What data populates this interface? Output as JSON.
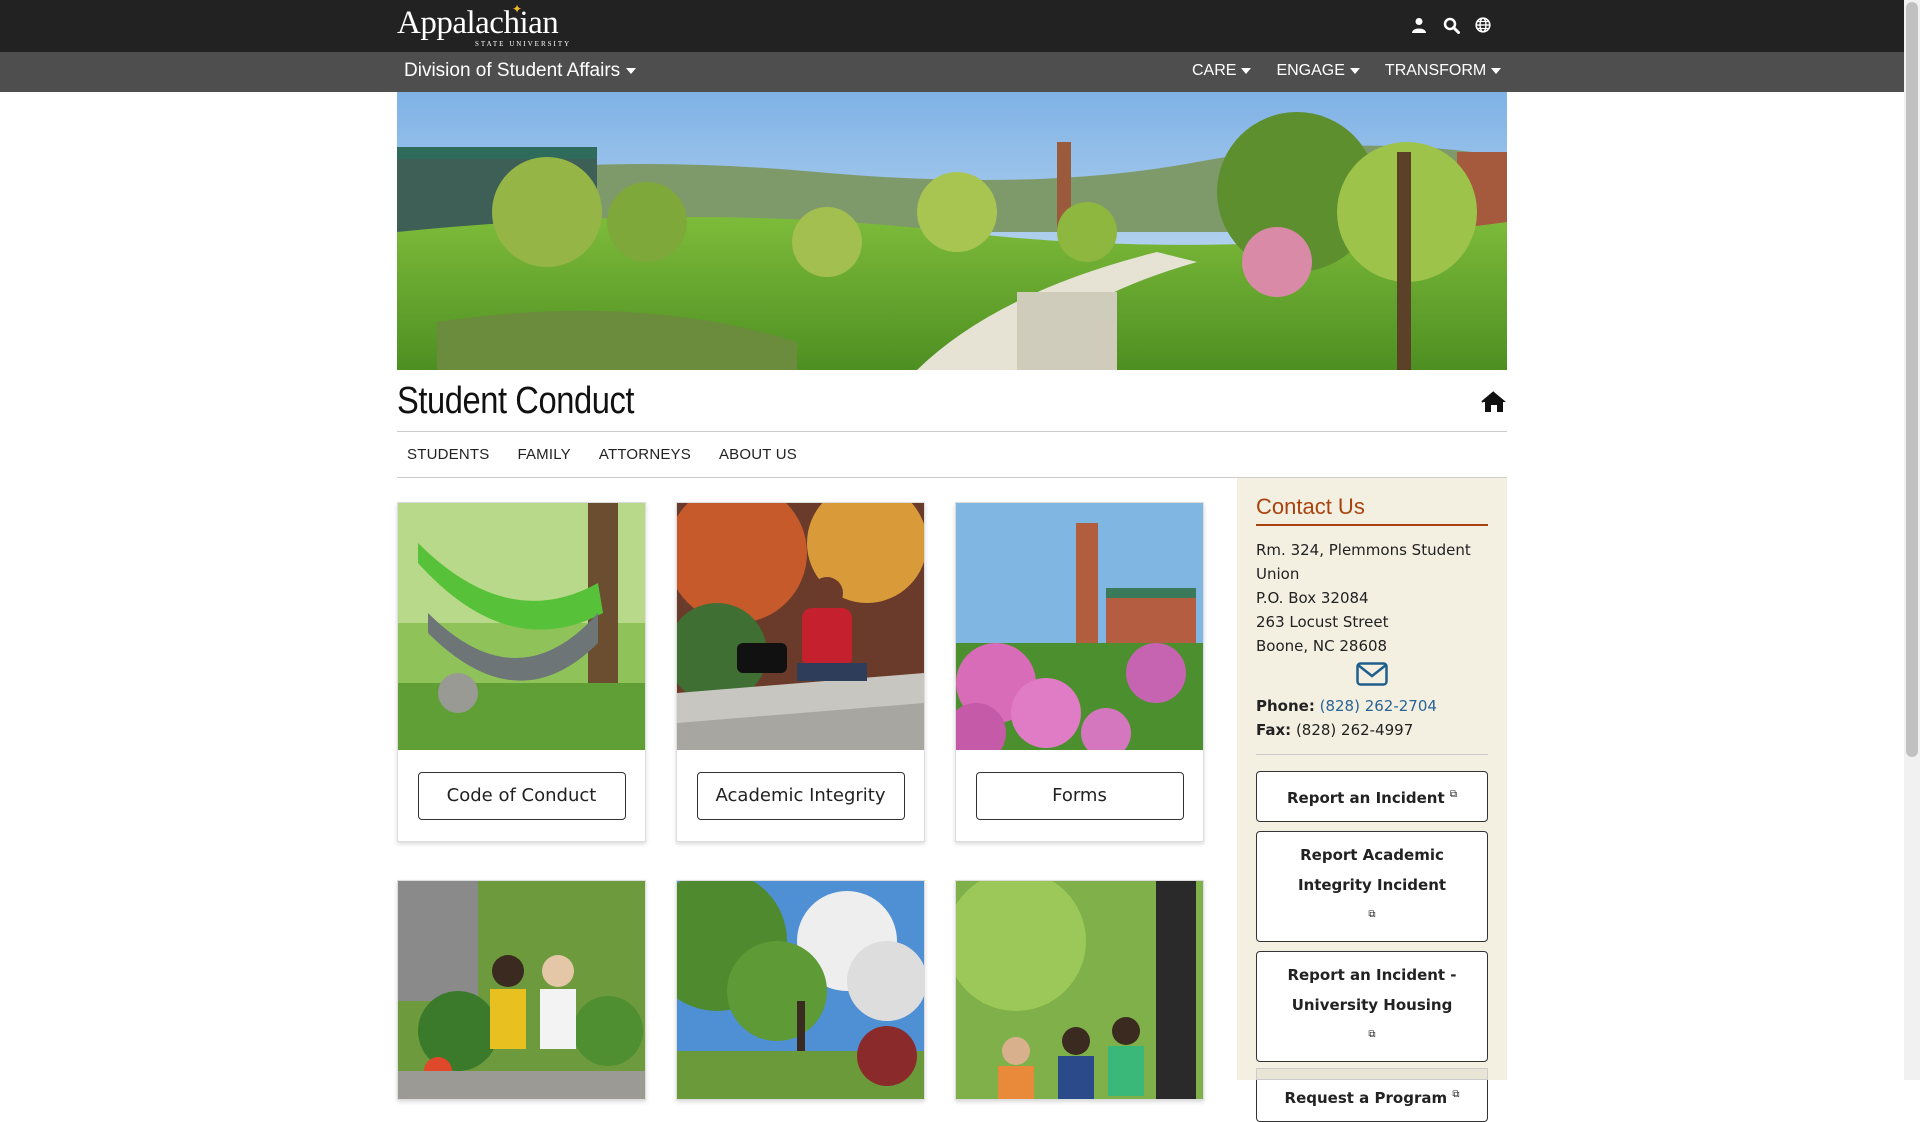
{
  "topbar": {
    "logo_text": "Appalachian",
    "logo_sub": "STATE UNIVERSITY",
    "icons": [
      "user-icon",
      "search-icon",
      "globe-icon"
    ]
  },
  "subnav": {
    "division_label": "Division of Student Affairs",
    "links": [
      {
        "label": "CARE"
      },
      {
        "label": "ENGAGE"
      },
      {
        "label": "TRANSFORM"
      }
    ]
  },
  "page": {
    "title": "Student Conduct"
  },
  "secondary_nav": {
    "tabs": [
      {
        "label": "STUDENTS"
      },
      {
        "label": "FAMILY"
      },
      {
        "label": "ATTORNEYS"
      },
      {
        "label": "ABOUT US"
      }
    ]
  },
  "cards": [
    {
      "label": "Code of Conduct"
    },
    {
      "label": "Academic Integrity"
    },
    {
      "label": "Forms"
    }
  ],
  "sidebar": {
    "title": "Contact Us",
    "address_lines": [
      "Rm. 324, Plemmons Student",
      "Union",
      "P.O. Box 32084",
      "263 Locust Street",
      "Boone, NC 28608"
    ],
    "phone_label": "Phone:",
    "phone_value": "(828) 262-2704",
    "fax_label": "Fax:",
    "fax_value": "(828) 262-4997",
    "buttons": [
      {
        "label": "Report an Incident"
      },
      {
        "label": "Report Academic Integrity Incident"
      },
      {
        "label": "Report an Incident - University Housing"
      },
      {
        "label": "Request a Program"
      }
    ]
  },
  "colors": {
    "topbar": "#222222",
    "subnav": "#4e4e4e",
    "accent": "#a8430f",
    "link": "#2a6496",
    "sidebar_bg": "#f3efe1"
  }
}
